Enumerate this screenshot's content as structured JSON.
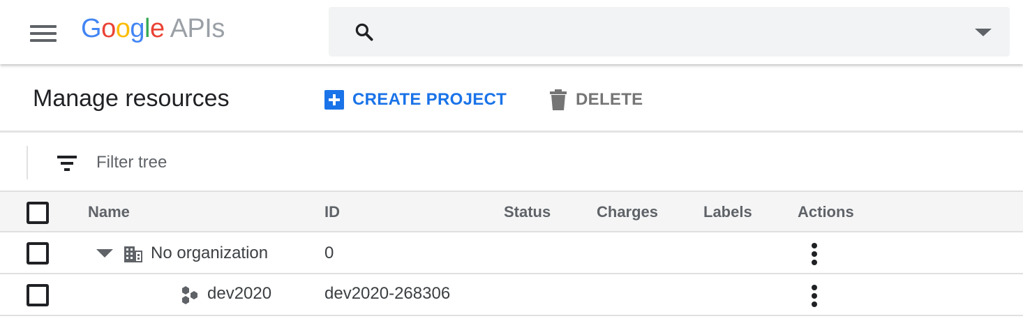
{
  "appbar": {
    "logo_google": "Google",
    "logo_apis": "APIs",
    "search": {
      "value": "",
      "placeholder": ""
    }
  },
  "header": {
    "title": "Manage resources",
    "create_label": "CREATE PROJECT",
    "delete_label": "DELETE"
  },
  "filter": {
    "placeholder": "Filter tree"
  },
  "table": {
    "columns": [
      "Name",
      "ID",
      "Status",
      "Charges",
      "Labels",
      "Actions"
    ],
    "rows": [
      {
        "name": "No organization",
        "id": "0",
        "status": "",
        "charges": "",
        "labels": "",
        "icon": "organization-icon",
        "expanded": true
      },
      {
        "name": "dev2020",
        "id": "dev2020-268306",
        "status": "",
        "charges": "",
        "labels": "",
        "icon": "project-icon"
      }
    ]
  },
  "colors": {
    "accent": "#1a73e8",
    "google_blue": "#4285f4",
    "google_red": "#ea4335",
    "google_yellow": "#fbbc05",
    "google_green": "#34a853"
  }
}
